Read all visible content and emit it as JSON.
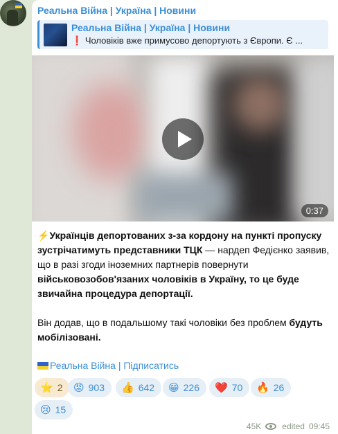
{
  "channel": {
    "name": "Реальна Війна | Україна | Новини"
  },
  "reply": {
    "title": "Реальна Війна | Україна | Новини",
    "mark": "❗",
    "text": "Чоловіків вже примусово депортують з Європи. Є ..."
  },
  "video": {
    "duration": "0:37",
    "play_icon": "play-icon"
  },
  "message": {
    "lead_emoji": "⚡",
    "p1_bold1": "Українців депортованих з-за кордону на пункті пропуску зустрічатимуть представники ТЦК",
    "p1_normal1": " — нардеп Федієнко заявив, що в разі згоди іноземних партнерів повернути ",
    "p1_bold2": "військовозобов'язаних чоловіків в Україну, то це буде звичайна процедура депортації.",
    "p2_normal": "Він додав, що в подальшому такі чоловіки без проблем ",
    "p2_bold": "будуть мобілізовані."
  },
  "subscribe": {
    "label": "Реальна Війна | Підписатись"
  },
  "reactions": [
    {
      "emoji": "⭐",
      "count": "2",
      "name": "star"
    },
    {
      "emoji": "😡",
      "count": "903",
      "name": "angry"
    },
    {
      "emoji": "👍",
      "count": "642",
      "name": "thumbs-up"
    },
    {
      "emoji": "😁",
      "count": "226",
      "name": "grin"
    },
    {
      "emoji": "❤️",
      "count": "70",
      "name": "heart"
    },
    {
      "emoji": "🔥",
      "count": "26",
      "name": "fire"
    },
    {
      "emoji": "😢",
      "count": "15",
      "name": "cry"
    }
  ],
  "meta": {
    "views": "45K",
    "edited": "edited",
    "time": "09:45"
  },
  "colors": {
    "accent": "#3a8fd6",
    "background": "#dfe7d6",
    "reaction_bg": "#e6eef6"
  }
}
